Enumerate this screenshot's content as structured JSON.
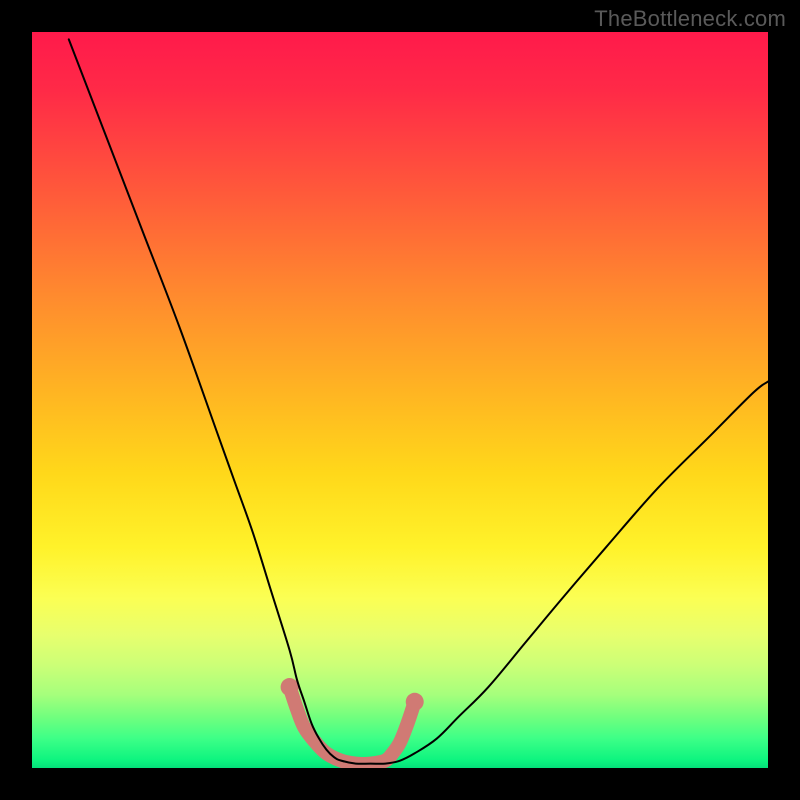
{
  "watermark": "TheBottleneck.com",
  "chart_data": {
    "type": "line",
    "title": "",
    "xlabel": "",
    "ylabel": "",
    "x_range": [
      0,
      100
    ],
    "y_range": [
      0,
      100
    ],
    "background": "rainbow-vertical-gradient",
    "background_stops": [
      {
        "t": 0.0,
        "color": "#ff1a4b"
      },
      {
        "t": 0.5,
        "color": "#ffd81a"
      },
      {
        "t": 0.78,
        "color": "#fbff54"
      },
      {
        "t": 0.93,
        "color": "#72ff7e"
      },
      {
        "t": 1.0,
        "color": "#04e07a"
      }
    ],
    "series": [
      {
        "name": "bottleneck-curve",
        "color": "#000000",
        "x": [
          5,
          10,
          15,
          20,
          25,
          27.5,
          30,
          32.5,
          35,
          36,
          37,
          38,
          39,
          40,
          41,
          42,
          44,
          46,
          48,
          50,
          52,
          55,
          58,
          62,
          67,
          72,
          78,
          85,
          92,
          98,
          100
        ],
        "y": [
          99,
          86,
          73,
          60,
          46,
          39,
          32,
          24,
          16,
          12,
          9,
          6,
          4,
          2.5,
          1.5,
          1,
          0.6,
          0.6,
          0.6,
          1,
          2,
          4,
          7,
          11,
          17,
          23,
          30,
          38,
          45,
          51,
          52.5
        ]
      }
    ],
    "trough": {
      "name": "trough-band",
      "color": "#d07a74",
      "thickness": 14,
      "x": [
        35,
        36,
        37,
        38.5,
        40,
        42,
        44,
        46,
        48,
        49,
        50,
        51,
        52
      ],
      "y": [
        11,
        8,
        5.5,
        3.5,
        2,
        1,
        0.6,
        0.6,
        1,
        2,
        3.5,
        6,
        9
      ],
      "endpoint_radius": 9,
      "endpoints": [
        {
          "x": 35,
          "y": 11
        },
        {
          "x": 52,
          "y": 9
        }
      ]
    }
  }
}
